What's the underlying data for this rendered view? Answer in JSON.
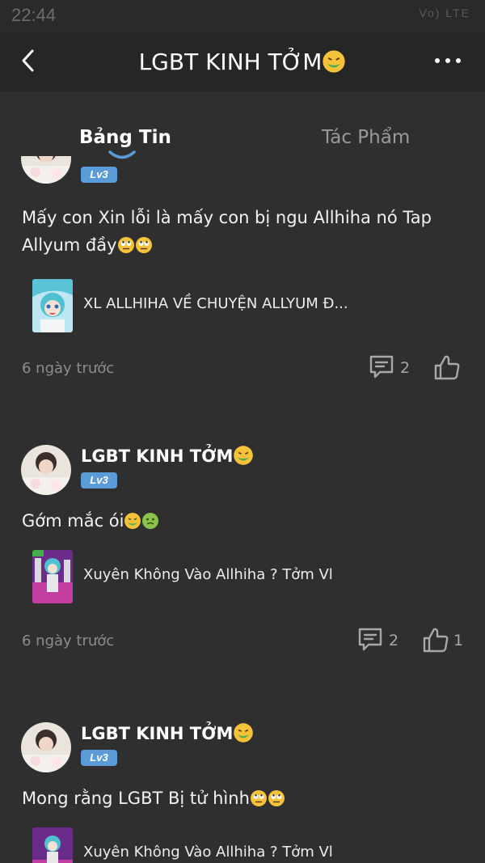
{
  "status_bar": {
    "time": "22:44",
    "signal_text": "Vo) LTE"
  },
  "header": {
    "title": "LGBT KINH TỞM",
    "title_emoji": "nauseated-face"
  },
  "tabs": [
    {
      "label": "Bảng Tin",
      "active": true
    },
    {
      "label": "Tác Phẩm",
      "active": false
    }
  ],
  "posts": [
    {
      "badge": "Lv3",
      "content": "Mấy con Xin lỗi là mấy con bị ngu Allhiha nó Tap Allyum đầy",
      "content_emojis": [
        "face-with-rolling-eyes",
        "face-with-rolling-eyes"
      ],
      "attachment_title": "XL ALLHIHA VỀ CHUYỆN ALLYUM Đ...",
      "time": "6 ngày trước",
      "comments": "2",
      "likes": ""
    },
    {
      "username": "LGBT KINH TỞM",
      "badge": "Lv3",
      "content": "Gớm mắc ói",
      "content_emojis": [
        "nauseated-face",
        "sick-face"
      ],
      "attachment_title": "Xuyên Không Vào Allhiha ? Tởm Vl",
      "time": "6 ngày trước",
      "comments": "2",
      "likes": "1"
    },
    {
      "username": "LGBT KINH TỞM",
      "badge": "Lv3",
      "content": "Mong rằng LGBT Bị tử hình",
      "content_emojis": [
        "face-with-rolling-eyes",
        "face-with-rolling-eyes"
      ],
      "attachment_title": "Xuyên Không Vào Allhiha ? Tởm Vl"
    }
  ],
  "colors": {
    "accent": "#5b9bd8",
    "background": "#2f2f2f",
    "header": "#262626"
  }
}
